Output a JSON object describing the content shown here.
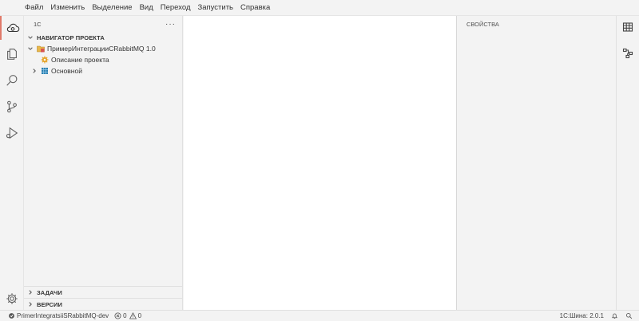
{
  "menu": [
    "Файл",
    "Изменить",
    "Выделение",
    "Вид",
    "Переход",
    "Запустить",
    "Справка"
  ],
  "activity_bar": {
    "items": [
      "cloud-icon",
      "files-icon",
      "search-icon",
      "source-control-icon",
      "run-debug-icon"
    ],
    "bottom": "settings-gear-icon",
    "active_accent": "#e07a6a"
  },
  "sidebar": {
    "title": "1С",
    "more": "···",
    "navigator": {
      "header": "НАВИГАТОР ПРОЕКТА",
      "project": "ПримерИнтеграцииСRabbitMQ 1.0",
      "description": "Описание проекта",
      "subsystem": "Основной"
    },
    "tasks_header": "ЗАДАЧИ",
    "versions_header": "ВЕРСИИ"
  },
  "properties": {
    "title": "СВОЙСТВА"
  },
  "right_bar": [
    "table-icon",
    "hierarchy-icon"
  ],
  "status": {
    "branch": "PrimerIntegratsiiSRabbitMQ-dev",
    "errors": "0",
    "warnings": "0",
    "version": "1С:Шина: 2.0.1"
  }
}
